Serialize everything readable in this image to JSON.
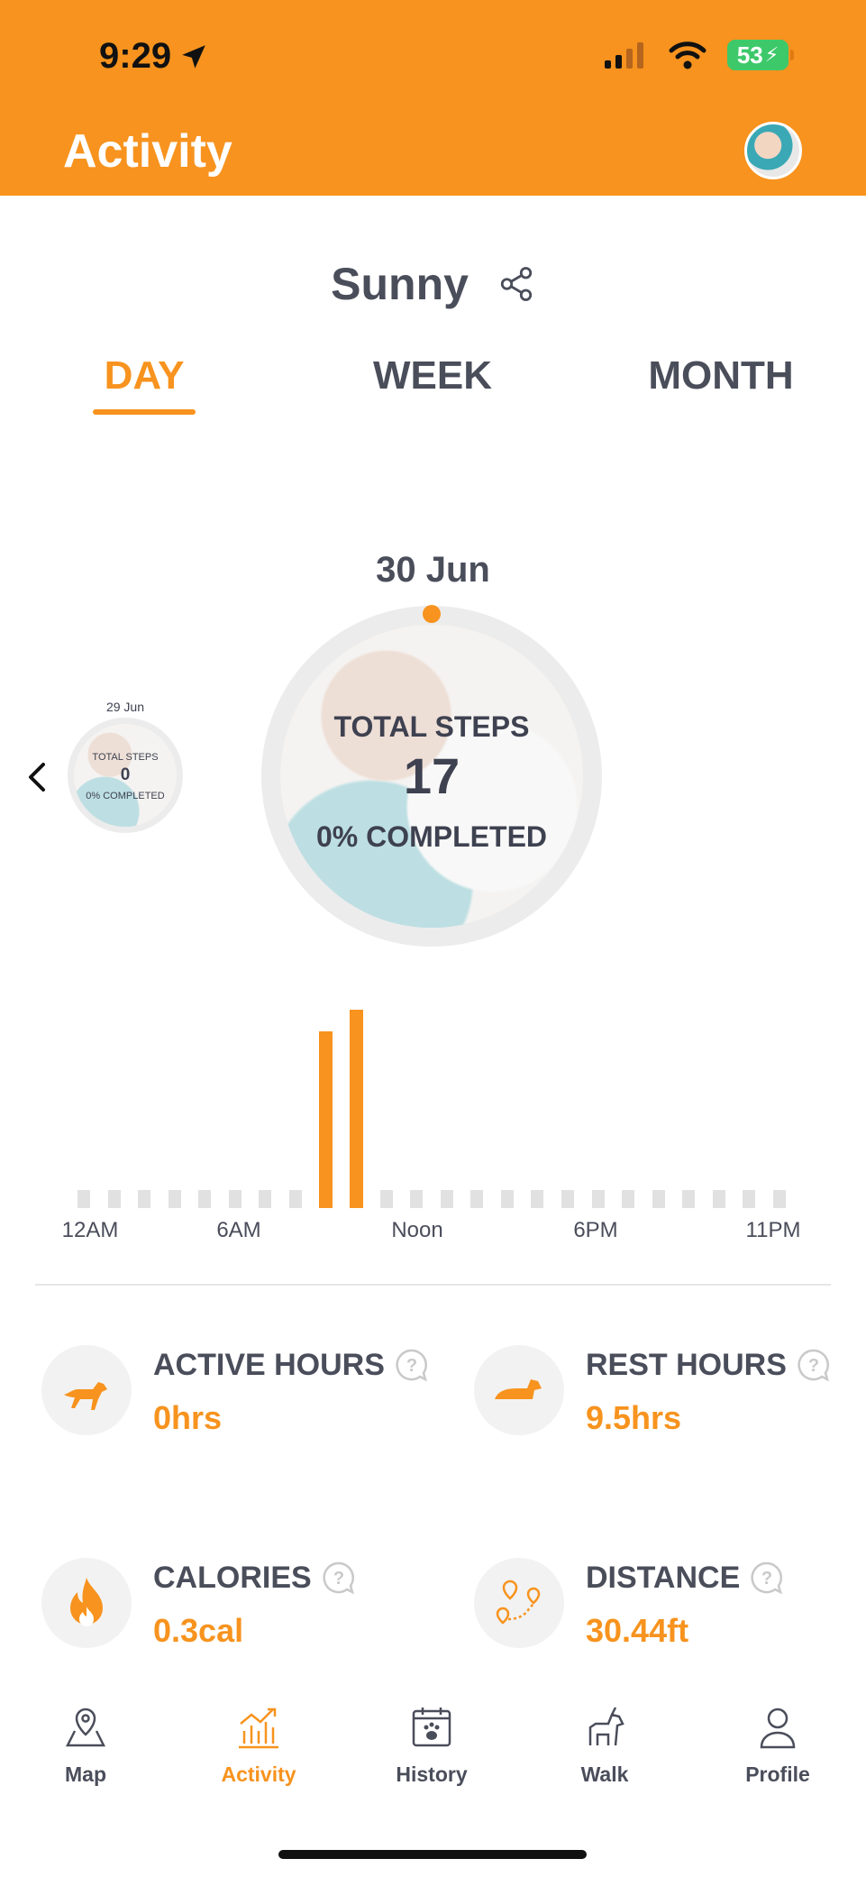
{
  "status_bar": {
    "time": "9:29",
    "battery": "53"
  },
  "header": {
    "title": "Activity"
  },
  "dog": {
    "name": "Sunny"
  },
  "tabs": [
    {
      "label": "DAY",
      "active": true
    },
    {
      "label": "WEEK",
      "active": false
    },
    {
      "label": "MONTH",
      "active": false
    }
  ],
  "current_day": {
    "date": "30 Jun",
    "title": "TOTAL STEPS",
    "steps": "17",
    "completed": "0% COMPLETED"
  },
  "previous_day": {
    "date": "29 Jun",
    "title": "TOTAL STEPS",
    "steps": "0",
    "completed": "0% COMPLETED"
  },
  "chart_data": {
    "type": "bar",
    "x_labels": [
      "12AM",
      "6AM",
      "Noon",
      "6PM",
      "11PM"
    ],
    "hours": 24,
    "values": [
      0,
      0,
      0,
      0,
      0,
      0,
      0,
      0,
      8,
      9,
      0,
      0,
      0,
      0,
      0,
      0,
      0,
      0,
      0,
      0,
      0,
      0,
      0,
      0
    ],
    "bar_color": "#f7931e",
    "empty_color": "#e1e1e1"
  },
  "stats": {
    "active_hours": {
      "label": "ACTIVE HOURS",
      "value": "0hrs",
      "icon": "running-dog-icon"
    },
    "rest_hours": {
      "label": "REST HOURS",
      "value": "9.5hrs",
      "icon": "resting-dog-icon"
    },
    "calories": {
      "label": "CALORIES",
      "value": "0.3cal",
      "icon": "flame-icon"
    },
    "distance": {
      "label": "DISTANCE",
      "value": "30.44ft",
      "icon": "route-pins-icon"
    }
  },
  "tabbar": [
    {
      "label": "Map",
      "icon": "map-pin-icon",
      "active": false
    },
    {
      "label": "Activity",
      "icon": "activity-chart-icon",
      "active": true
    },
    {
      "label": "History",
      "icon": "calendar-paw-icon",
      "active": false
    },
    {
      "label": "Walk",
      "icon": "dog-walk-icon",
      "active": false
    },
    {
      "label": "Profile",
      "icon": "person-icon",
      "active": false
    }
  ],
  "colors": {
    "accent": "#f7931e",
    "text": "#4a4d5a"
  }
}
